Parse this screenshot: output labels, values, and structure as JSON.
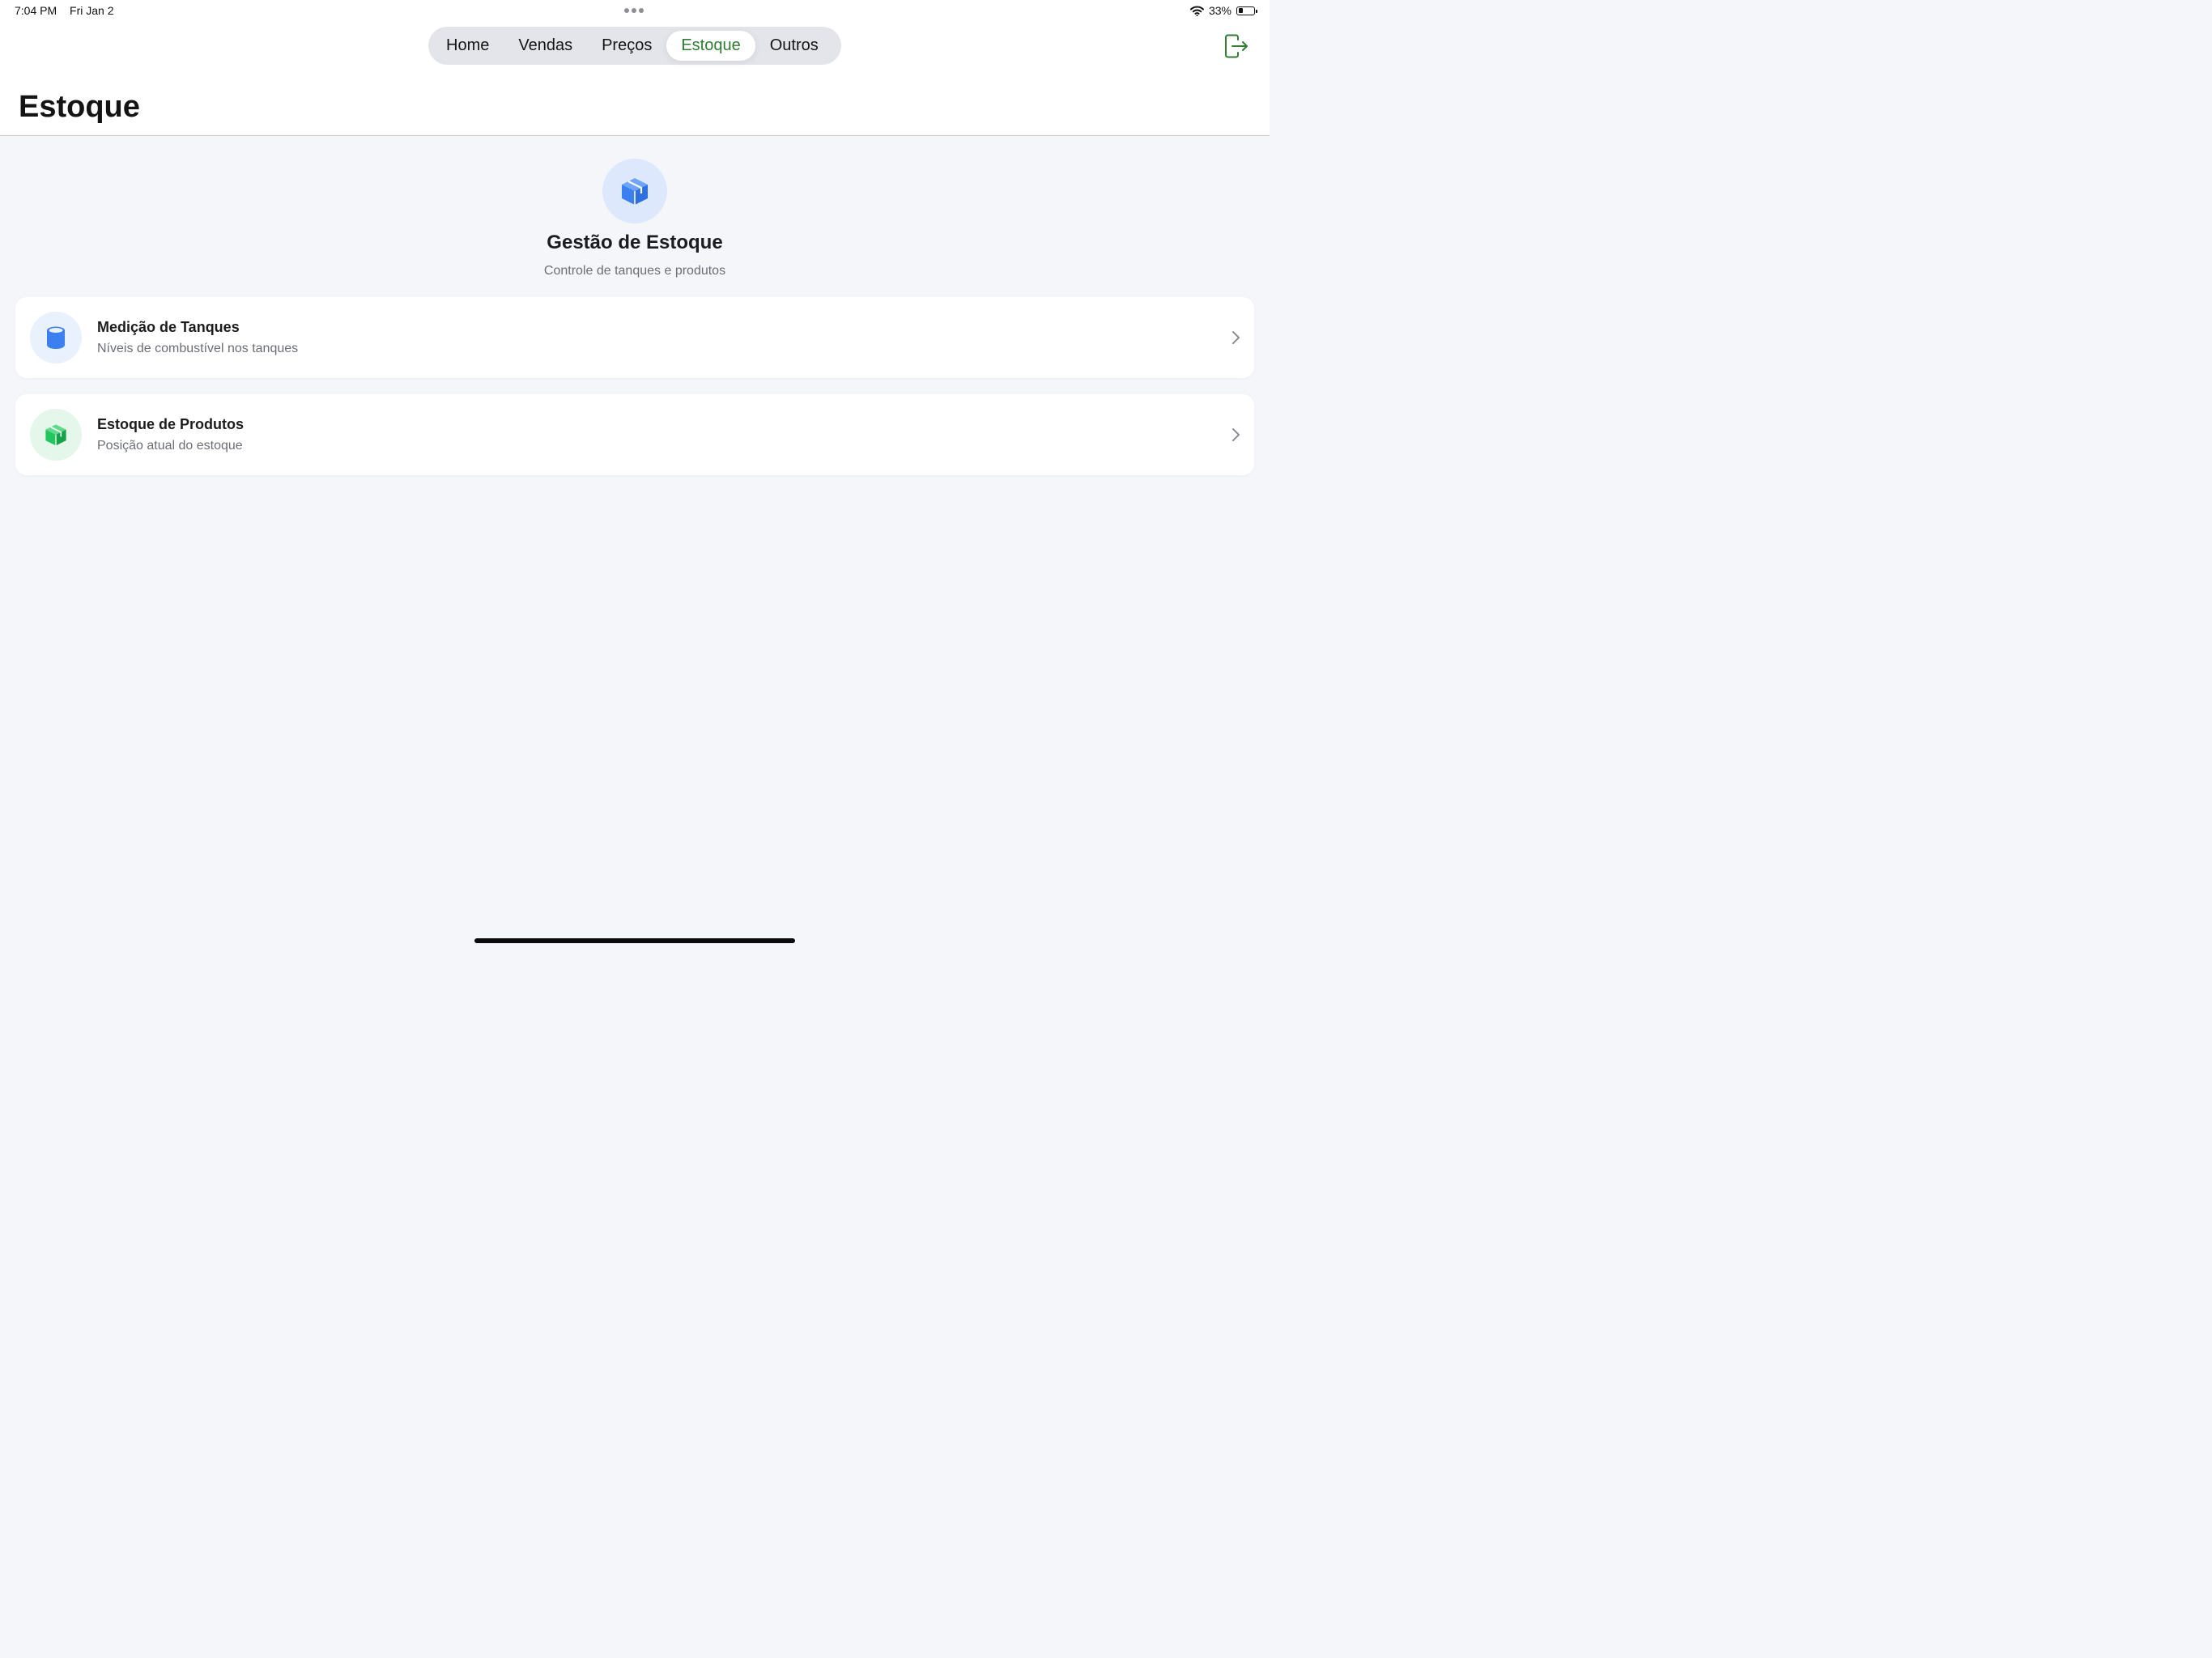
{
  "status_bar": {
    "time": "7:04 PM",
    "date": "Fri Jan 2",
    "battery": "33%",
    "battery_level": 0.33
  },
  "tabs": [
    {
      "label": "Home",
      "active": false
    },
    {
      "label": "Vendas",
      "active": false
    },
    {
      "label": "Preços",
      "active": false
    },
    {
      "label": "Estoque",
      "active": true
    },
    {
      "label": "Outros",
      "active": false
    }
  ],
  "page": {
    "title": "Estoque"
  },
  "hero": {
    "icon": "package-icon",
    "title": "Gestão de Estoque",
    "subtitle": "Controle de tanques e produtos"
  },
  "cards": [
    {
      "icon": "tank-cylinder-icon",
      "title": "Medição de Tanques",
      "subtitle": "Níveis de combustível nos tanques"
    },
    {
      "icon": "product-box-icon",
      "title": "Estoque de Produtos",
      "subtitle": "Posição atual do estoque"
    }
  ],
  "colors": {
    "accent_green": "#2e7d32",
    "icon_blue": "#3b7ff0",
    "icon_green": "#22c55e",
    "hero_icon_bg": "#dde8fc",
    "tank_icon_bg": "#e9f1fd",
    "product_icon_bg": "#e4f7ea",
    "background": "#f4f6fa"
  }
}
